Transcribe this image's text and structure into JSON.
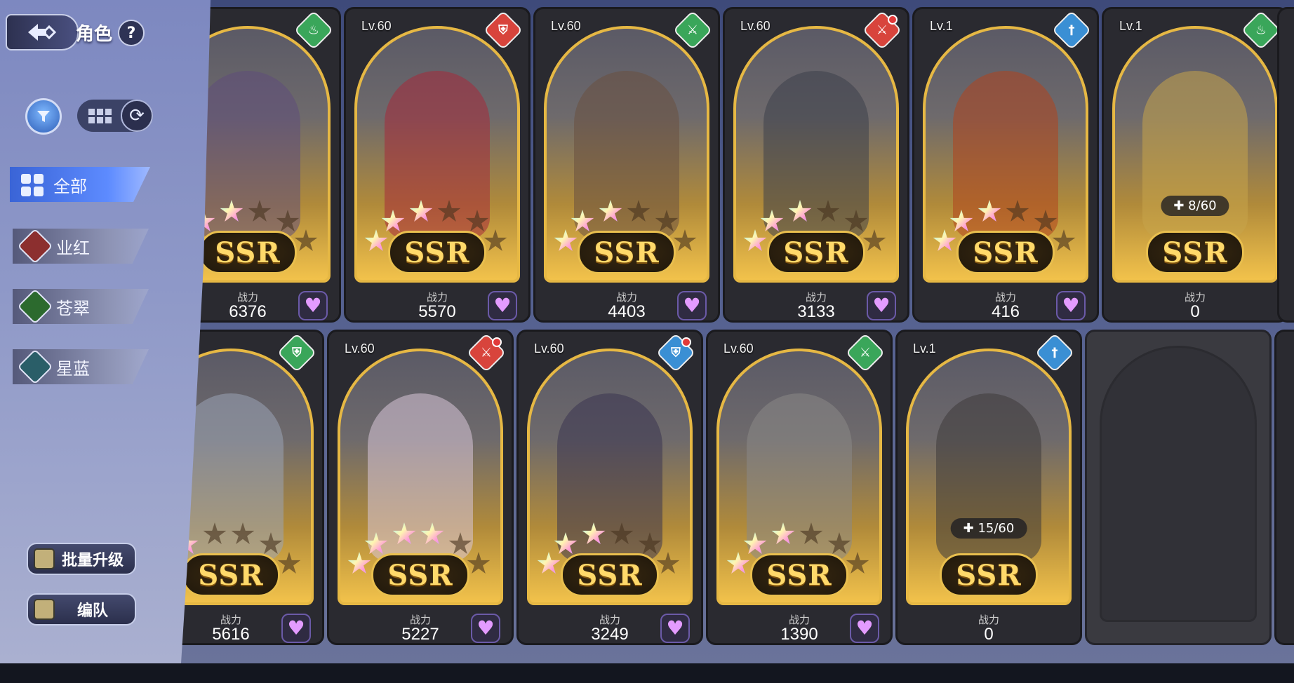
{
  "header": {
    "title": "角色",
    "help": "?"
  },
  "categories": [
    {
      "label": "全部",
      "active": true
    },
    {
      "label": "业红",
      "color": "#b03a3a"
    },
    {
      "label": "苍翠",
      "color": "#2f8a3f"
    },
    {
      "label": "星蓝",
      "color": "#2f7a86"
    }
  ],
  "buttons": {
    "batch_upgrade": "批量升级",
    "team": "编队"
  },
  "card_labels": {
    "power": "战力",
    "rarity": "SSR"
  },
  "cards": [
    {
      "lv": "",
      "element": "green",
      "role_icon": "fire-icon",
      "stars": 3,
      "power": "6376",
      "art": "#5e4d7a"
    },
    {
      "lv": "Lv.60",
      "element": "red",
      "role_icon": "shield-icon",
      "stars": 3,
      "power": "5570",
      "art": "#a52a3a"
    },
    {
      "lv": "Lv.60",
      "element": "green",
      "role_icon": "sword-icon",
      "stars": 3,
      "power": "4403",
      "art": "#6a5040"
    },
    {
      "lv": "Lv.60",
      "element": "red",
      "role_icon": "sword-icon",
      "stars": 3,
      "power": "3133",
      "art": "#3c3f4a",
      "dot": true
    },
    {
      "lv": "Lv.1",
      "element": "blue",
      "role_icon": "dagger-icon",
      "stars": 3,
      "power": "416",
      "art": "#b0441e"
    },
    {
      "lv": "Lv.1",
      "element": "green",
      "role_icon": "fire-icon",
      "stars": 0,
      "power": "0",
      "art": "#c7a44a",
      "fragments": "8/60"
    },
    {
      "lv": "",
      "element": "green",
      "role_icon": "shield-icon",
      "stars": 2,
      "power": "5616",
      "art": "#9aa4b6"
    },
    {
      "lv": "Lv.60",
      "element": "red",
      "role_icon": "sword-icon",
      "stars": 4,
      "power": "5227",
      "art": "#d9c7d8",
      "dot": true
    },
    {
      "lv": "Lv.60",
      "element": "blue",
      "role_icon": "shield-icon",
      "stars": 3,
      "power": "3249",
      "art": "#3b3550",
      "dot": true
    },
    {
      "lv": "Lv.60",
      "element": "green",
      "role_icon": "sword-icon",
      "stars": 3,
      "power": "1390",
      "art": "#8b8886"
    },
    {
      "lv": "Lv.1",
      "element": "blue",
      "role_icon": "dagger-icon",
      "stars": 0,
      "power": "0",
      "art": "#3e3a3a",
      "fragments": "15/60"
    }
  ],
  "colors": {
    "red": "#d8443c",
    "green": "#3aa65a",
    "blue": "#3a8fd4",
    "gold": "#e9bf4e"
  }
}
